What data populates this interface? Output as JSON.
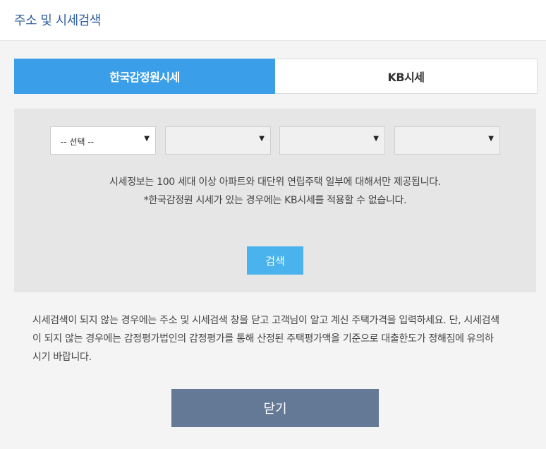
{
  "header": {
    "title": "주소 및 시세검색"
  },
  "tabs": [
    {
      "label": "한국감정원시세",
      "active": true
    },
    {
      "label": "KB시세",
      "active": false
    }
  ],
  "filters": [
    {
      "value": "-- 선택 --"
    },
    {
      "value": ""
    },
    {
      "value": ""
    },
    {
      "value": ""
    }
  ],
  "notice": {
    "line1": "시세정보는 100 세대 이상 아파트와 대단위 연립주택 일부에 대해서만 제공됩니다.",
    "line2": "*한국감정원 시세가 있는 경우에는 KB시세를 적용할 수 없습니다."
  },
  "search_button": {
    "label": "검색"
  },
  "guide": {
    "line1": "시세검색이 되지 않는 경우에는 주소 및 시세검색 창을 닫고 고객님이 알고 계신 주택가격을 입력하세요. 단, 시세검색",
    "line2": "이 되지 않는 경우에는 감정평가법인의 감정평가를 통해 산정된 주택평가액을 기준으로 대출한도가 정해짐에 유의하",
    "line3": "시기 바랍니다."
  },
  "close_button": {
    "label": "닫기"
  },
  "colors": {
    "tab_active": "#3a9ee8",
    "search_button": "#4ab3ee",
    "close_button": "#637996",
    "title": "#2f5f9e"
  }
}
